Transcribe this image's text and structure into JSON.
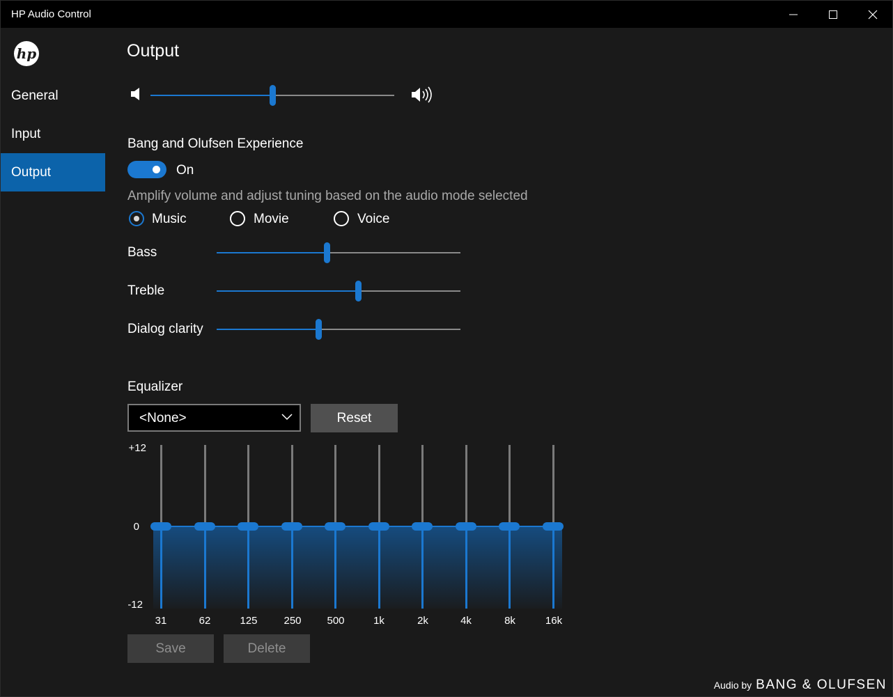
{
  "window": {
    "title": "HP Audio Control",
    "controls": [
      "minimize-icon",
      "maximize-icon",
      "close-icon"
    ]
  },
  "sidebar": {
    "logo_text": "hp",
    "items": [
      {
        "label": "General",
        "active": false
      },
      {
        "label": "Input",
        "active": false
      },
      {
        "label": "Output",
        "active": true
      }
    ]
  },
  "output": {
    "title": "Output",
    "volume": {
      "value_percent": 50,
      "mute_icon": "speaker-icon",
      "loud_icon": "speaker-loud-icon"
    },
    "bo_experience": {
      "label": "Bang and Olufsen Experience",
      "toggle_state": "On",
      "description": "Amplify volume and adjust tuning based on the audio mode selected"
    },
    "modes": [
      {
        "label": "Music",
        "checked": true
      },
      {
        "label": "Movie",
        "checked": false
      },
      {
        "label": "Voice",
        "checked": false
      }
    ],
    "tuning": [
      {
        "label": "Bass",
        "value_percent": 45
      },
      {
        "label": "Treble",
        "value_percent": 58
      },
      {
        "label": "Dialog clarity",
        "value_percent": 42
      }
    ],
    "equalizer": {
      "label": "Equalizer",
      "preset": "<None>",
      "reset_label": "Reset",
      "scale": {
        "max": "+12",
        "zero": "0",
        "min": "-12"
      },
      "bands": [
        {
          "freq": "31",
          "gain": 0
        },
        {
          "freq": "62",
          "gain": 0
        },
        {
          "freq": "125",
          "gain": 0
        },
        {
          "freq": "250",
          "gain": 0
        },
        {
          "freq": "500",
          "gain": 0
        },
        {
          "freq": "1k",
          "gain": 0
        },
        {
          "freq": "2k",
          "gain": 0
        },
        {
          "freq": "4k",
          "gain": 0
        },
        {
          "freq": "8k",
          "gain": 0
        },
        {
          "freq": "16k",
          "gain": 0
        }
      ],
      "save_label": "Save",
      "delete_label": "Delete"
    }
  },
  "footer": {
    "audio_by": "Audio by",
    "brand": "BANG & OLUFSEN"
  },
  "colors": {
    "accent": "#1b78d0",
    "nav_active": "#0c63aa",
    "background": "#1a1a1a",
    "titlebar": "#000000"
  }
}
